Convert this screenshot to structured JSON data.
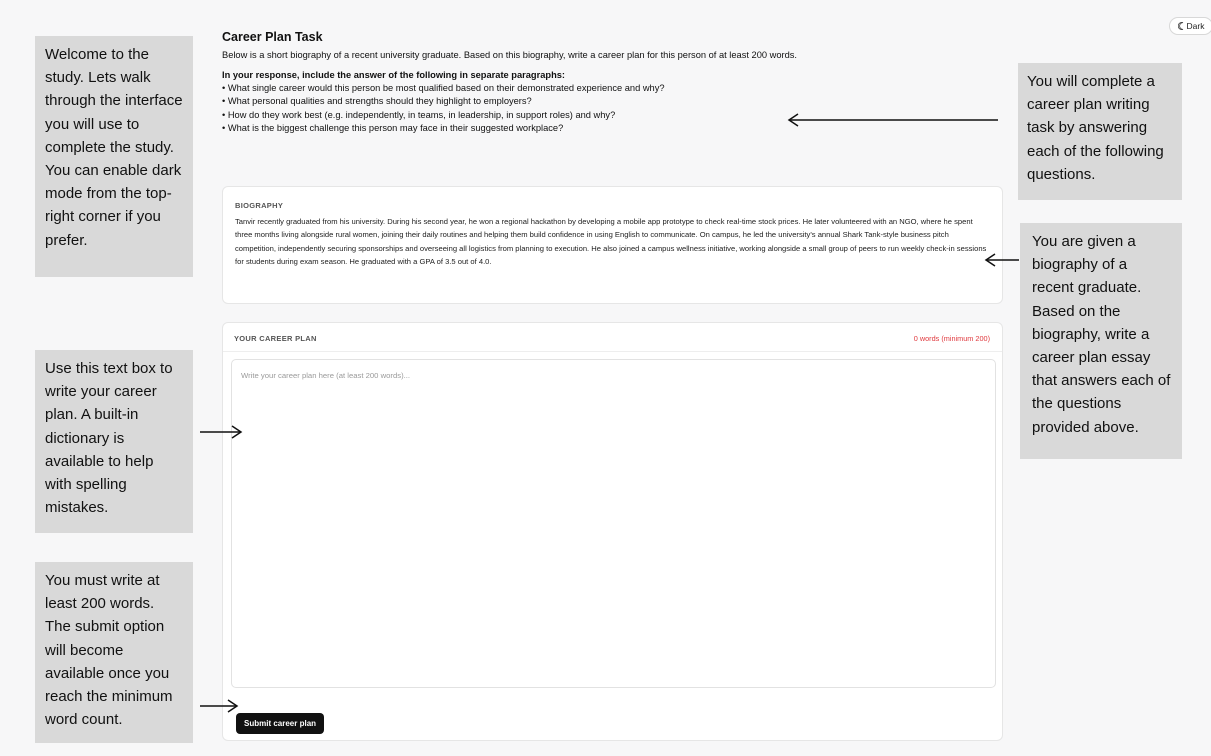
{
  "task": {
    "title": "Career Plan Task",
    "intro": "Below is a short biography of a recent university graduate. Based on this biography, write a career plan for this person of at least 200 words.",
    "questions_heading": "In your response, include the answer of the following in separate paragraphs:",
    "questions": [
      "What single career would this person be most qualified based on their demonstrated experience and why?",
      "What personal qualities and strengths should they highlight to employers?",
      "How do they work best (e.g. independently, in teams, in leadership, in support roles) and why?",
      "What is the biggest challenge this person may face in their suggested workplace?"
    ]
  },
  "biography": {
    "label": "BIOGRAPHY",
    "text": "Tanvir recently graduated from his university. During his second year, he won a regional hackathon by developing a mobile app prototype to check real-time stock prices. He later volunteered with an NGO, where he spent three months living alongside rural women, joining their daily routines and helping them build confidence in using English to communicate. On campus, he led the university's annual Shark Tank-style business pitch competition, independently securing sponsorships and overseeing all logistics from planning to execution. He also joined a campus wellness initiative, working alongside a small group of peers to run weekly check-in sessions for students during exam season. He graduated with a GPA of 3.5 out of 4.0."
  },
  "plan": {
    "label": "YOUR CAREER PLAN",
    "word_count": "0 words (minimum 200)",
    "placeholder": "Write your career plan here (at least 200 words)...",
    "submit_label": "Submit career plan"
  },
  "theme_toggle": {
    "icon": "moon-icon",
    "label": "Dark"
  },
  "annotations": {
    "welcome": "Welcome to the study. Lets walk through the interface you will use to complete the study.  You can enable dark mode from the top-right corner if you prefer.",
    "text_box": "Use this text box to write your career plan. A built-in dictionary is available to help with spelling mistakes.",
    "min_words": "You must write at least 200 words. The submit option will become available once you reach the minimum word count.",
    "task_desc": "You will complete a career plan writing task by answering each of the following questions.",
    "biography_desc": "You are given a biography of a recent graduate. Based on the biography, write a career plan essay that answers each of the questions provided above."
  }
}
